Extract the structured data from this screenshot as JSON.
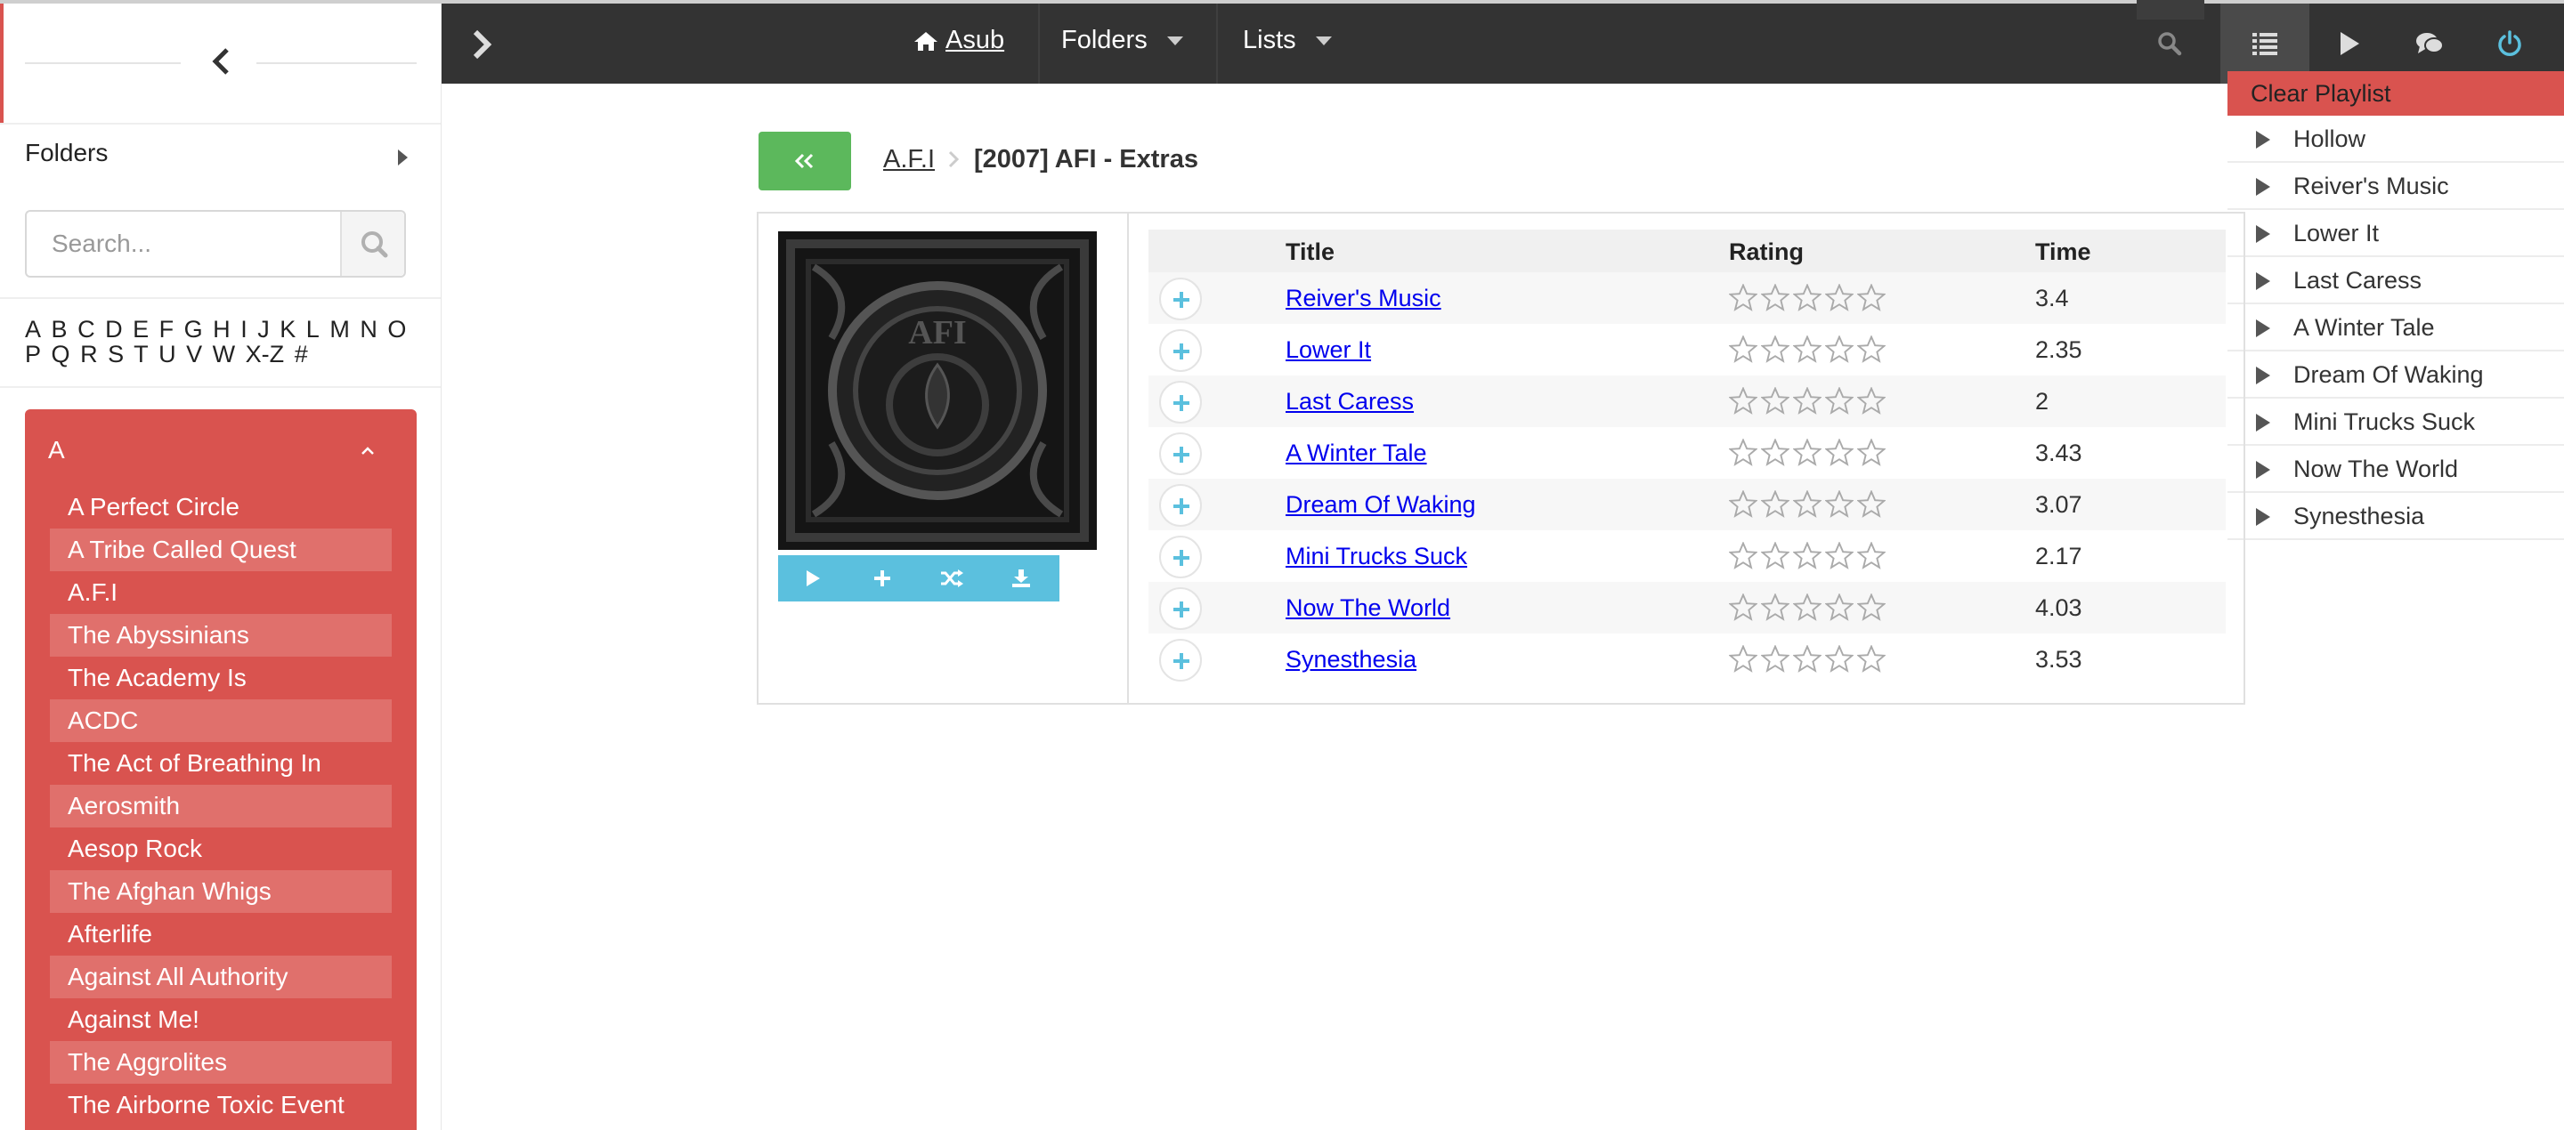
{
  "sidebar": {
    "folders_label": "Folders",
    "search_placeholder": "Search...",
    "alphabet": [
      "A",
      "B",
      "C",
      "D",
      "E",
      "F",
      "G",
      "H",
      "I",
      "J",
      "K",
      "L",
      "M",
      "N",
      "O",
      "P",
      "Q",
      "R",
      "S",
      "T",
      "U",
      "V",
      "W",
      "X-Z",
      "#"
    ],
    "group_letter": "A",
    "artists": [
      "A Perfect Circle",
      "A Tribe Called Quest",
      "A.F.I",
      "The Abyssinians",
      "The Academy Is",
      "ACDC",
      "The Act of Breathing In",
      "Aerosmith",
      "Aesop Rock",
      "The Afghan Whigs",
      "Afterlife",
      "Against All Authority",
      "Against Me!",
      "The Aggrolites",
      "The Airborne Toxic Event"
    ]
  },
  "navbar": {
    "home_label": "Asub",
    "folders_label": "Folders",
    "lists_label": "Lists",
    "icons": [
      "search-icon",
      "playlist-icon",
      "play-icon",
      "chat-icon",
      "power-icon"
    ],
    "power_color": "#5bc0de"
  },
  "playlist": {
    "clear_label": "Clear Playlist",
    "items": [
      "Hollow",
      "Reiver's Music",
      "Lower It",
      "Last Caress",
      "A Winter Tale",
      "Dream Of Waking",
      "Mini Trucks Suck",
      "Now The World",
      "Synesthesia"
    ]
  },
  "album": {
    "artist": "A.F.I",
    "title": "[2007] AFI - Extras",
    "cover_text": "AFI",
    "columns": {
      "title": "Title",
      "rating": "Rating",
      "time": "Time"
    },
    "tracks": [
      {
        "title": "Reiver's Music",
        "rating": 0,
        "time": "3.4"
      },
      {
        "title": "Lower It",
        "rating": 0,
        "time": "2.35"
      },
      {
        "title": "Last Caress",
        "rating": 0,
        "time": "2"
      },
      {
        "title": "A Winter Tale",
        "rating": 0,
        "time": "3.43"
      },
      {
        "title": "Dream Of Waking",
        "rating": 0,
        "time": "3.07"
      },
      {
        "title": "Mini Trucks Suck",
        "rating": 0,
        "time": "2.17"
      },
      {
        "title": "Now The World",
        "rating": 0,
        "time": "4.03"
      },
      {
        "title": "Synesthesia",
        "rating": 0,
        "time": "3.53"
      }
    ]
  },
  "colors": {
    "accent_red": "#d9534f",
    "success_green": "#5cb85c",
    "info_blue": "#5bc0de",
    "navbar": "#333333"
  }
}
